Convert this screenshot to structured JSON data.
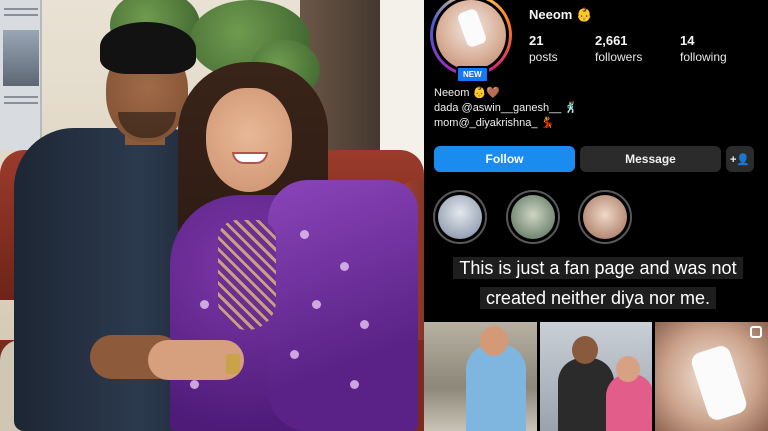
{
  "profile": {
    "username": "Neeom",
    "username_emoji": "👶",
    "new_badge": "NEW",
    "stats": [
      {
        "value": "21",
        "label": "posts"
      },
      {
        "value": "2,661",
        "label": "followers"
      },
      {
        "value": "14",
        "label": "following"
      }
    ],
    "bio": [
      "Neeom 👶🤎",
      "dada @aswin__ganesh__ 🕺",
      "mom@_diyakrishna_ 💃"
    ],
    "buttons": {
      "follow": "Follow",
      "message": "Message",
      "add_person": "+👤"
    },
    "highlights_count": 3,
    "caption_lines": [
      "This is just a fan page and was not",
      "created neither diya nor me."
    ],
    "posts_count_visible": 3
  },
  "colors": {
    "follow_blue": "#1a8cf0",
    "panel_bg": "#000000",
    "button_gray": "#2b2b2b",
    "new_badge_blue": "#1877f2"
  },
  "icons": [
    "user-plus-icon",
    "reel-icon"
  ]
}
